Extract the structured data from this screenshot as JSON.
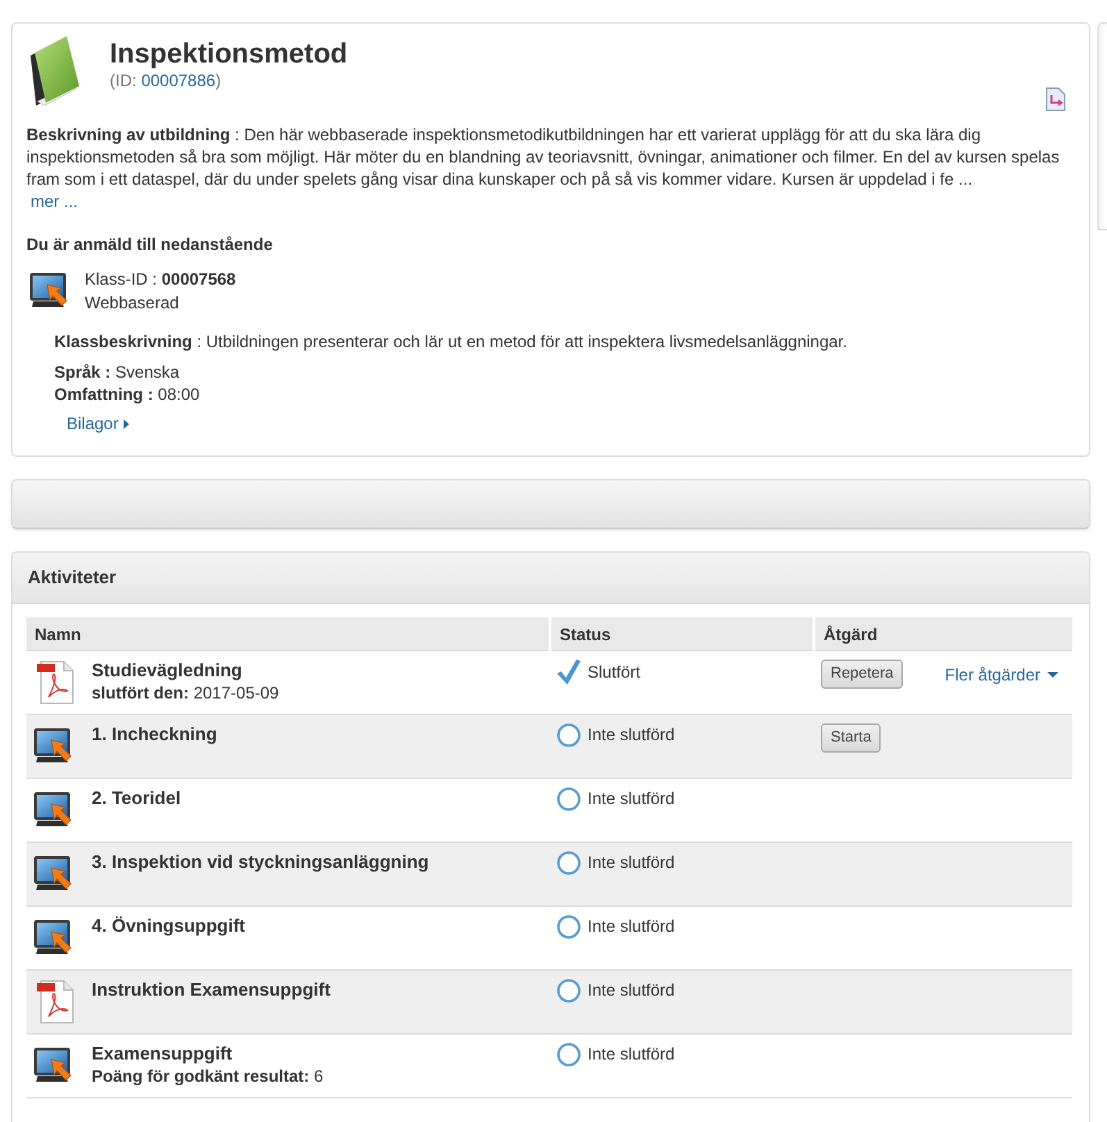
{
  "course": {
    "title": "Inspektionsmetod",
    "id_prefix": "(ID:",
    "id": "00007886",
    "id_suffix": ")",
    "description": "**Beskrivning av utbildning** : Den här webbaserade inspektionsmetodikutbildningen har ett varierat upplägg för att du ska lära dig inspektionsmetoden så bra som möjligt. Här möter du en blandning av teoriavsnitt, övningar, animationer och filmer. En del av kursen spelas fram som i ett dataspel, där du under spelets gång visar dina kunskaper och på så vis kommer vidare. Kursen är uppdelad i fe ...",
    "more_link": "mer ..."
  },
  "enrollment": {
    "heading": "Du är anmäld till nedanstående",
    "class_id": "Klass-ID : **00007568**",
    "delivery": "Webbaserad",
    "class_description": "**Klassbeskrivning** : Utbildningen presenterar och lär ut en metod för att inspektera livsmedelsanläggningar.",
    "facts": [
      "**Språk :** Svenska",
      "**Omfattning :** 08:00"
    ],
    "attachments_link": "Bilagor"
  },
  "activities": {
    "title": "Aktiviteter",
    "columns": [
      "Namn",
      "Status",
      "Åtgärd"
    ],
    "rows": [
      {
        "kind": "pdf",
        "name": "Studievägledning",
        "detail": "**slutfört den:** 2017-05-09",
        "completed": true,
        "status": "Slutfört",
        "action": "Repetera",
        "more_actions": "Fler åtgärder"
      },
      {
        "kind": "web",
        "name": "1. Incheckning",
        "completed": false,
        "status": "Inte slutförd",
        "action": "Starta"
      },
      {
        "kind": "web",
        "name": "2. Teoridel",
        "completed": false,
        "status": "Inte slutförd"
      },
      {
        "kind": "web",
        "name": "3. Inspektion vid styckningsanläggning",
        "completed": false,
        "status": "Inte slutförd"
      },
      {
        "kind": "web",
        "name": "4. Övningsuppgift",
        "completed": false,
        "status": "Inte slutförd"
      },
      {
        "kind": "pdf",
        "name": "Instruktion Examensuppgift",
        "completed": false,
        "status": "Inte slutförd"
      },
      {
        "kind": "web",
        "name": "Examensuppgift",
        "detail": "**Poäng för godkänt resultat:** 6",
        "completed": false,
        "status": "Inte slutförd"
      }
    ]
  }
}
